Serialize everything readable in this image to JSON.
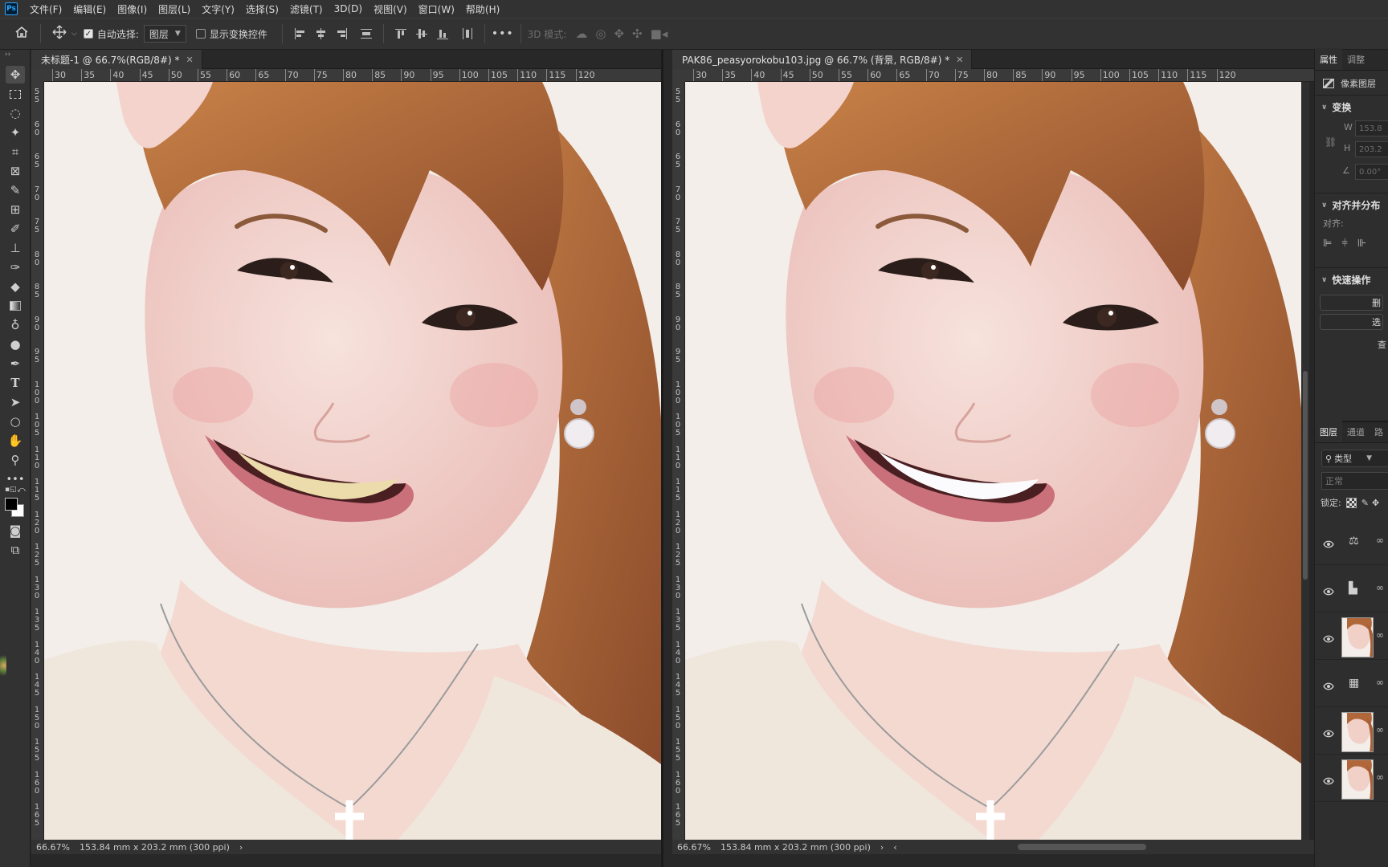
{
  "app": {
    "logo": "Ps",
    "menu": [
      "文件(F)",
      "编辑(E)",
      "图像(I)",
      "图层(L)",
      "文字(Y)",
      "选择(S)",
      "滤镜(T)",
      "3D(D)",
      "视图(V)",
      "窗口(W)",
      "帮助(H)"
    ]
  },
  "options": {
    "auto_select_label": "自动选择:",
    "auto_select_checked": true,
    "auto_select_target": "图层",
    "show_transform_label": "显示变换控件",
    "more": "•••",
    "mode3d_label": "3D 模式:"
  },
  "docs": [
    {
      "tab_title": "未标题-1 @ 66.7%(RGB/8#) *",
      "zoom": "66.67%",
      "size_info": "153.84 mm x 203.2 mm (300 ppi)",
      "teeth_color": "#ecdcab"
    },
    {
      "tab_title": "PAK86_peasyorokobu103.jpg @ 66.7% (背景, RGB/8#) *",
      "zoom": "66.67%",
      "size_info": "153.84 mm x 203.2 mm (300 ppi)",
      "teeth_color": "#fbfbfd"
    }
  ],
  "ruler": {
    "h_labels": [
      "30",
      "35",
      "40",
      "45",
      "50",
      "55",
      "60",
      "65",
      "70",
      "75",
      "80",
      "85",
      "90",
      "95",
      "100",
      "105",
      "110",
      "115",
      "120"
    ],
    "v_labels": [
      "5 5",
      "6 0",
      "6 5",
      "7 0",
      "7 5",
      "8 0",
      "8 5",
      "9 0",
      "9 5",
      "1 0 0",
      "1 0 5",
      "1 1 0",
      "1 1 5",
      "1 2 0",
      "1 2 5",
      "1 3 0",
      "1 3 5",
      "1 4 0",
      "1 4 5",
      "1 5 0",
      "1 5 5",
      "1 6 0",
      "1 6 5"
    ]
  },
  "properties_panel": {
    "tabs": [
      "属性",
      "调整"
    ],
    "layer_kind": "像素图层",
    "transform_title": "变换",
    "w_label": "W",
    "w_value": "153.8",
    "h_label": "H",
    "h_value": "203.2",
    "angle_value": "0.00°",
    "align_title": "对齐并分布",
    "align_label": "对齐:",
    "quick_title": "快速操作",
    "quick_btn1": "删",
    "quick_btn2": "选",
    "quick_link": "查"
  },
  "layers_panel": {
    "tabs": [
      "图层",
      "通道",
      "路"
    ],
    "filter_label": "类型",
    "blend_mode": "正常",
    "lock_label": "锁定:",
    "layers": [
      {
        "type": "adjustment",
        "icon": "balance-icon"
      },
      {
        "type": "adjustment",
        "icon": "levels-icon"
      },
      {
        "type": "pixel",
        "icon": "photo-thumb"
      },
      {
        "type": "adjustment",
        "icon": "film-icon"
      },
      {
        "type": "pixel",
        "icon": "photo-thumb"
      },
      {
        "type": "pixel",
        "icon": "photo-thumb"
      }
    ]
  },
  "colors": {
    "skin": "#f2d5cf",
    "hair": "#b0673a",
    "background": "#f3eee9",
    "lace": "#efe6dc"
  }
}
